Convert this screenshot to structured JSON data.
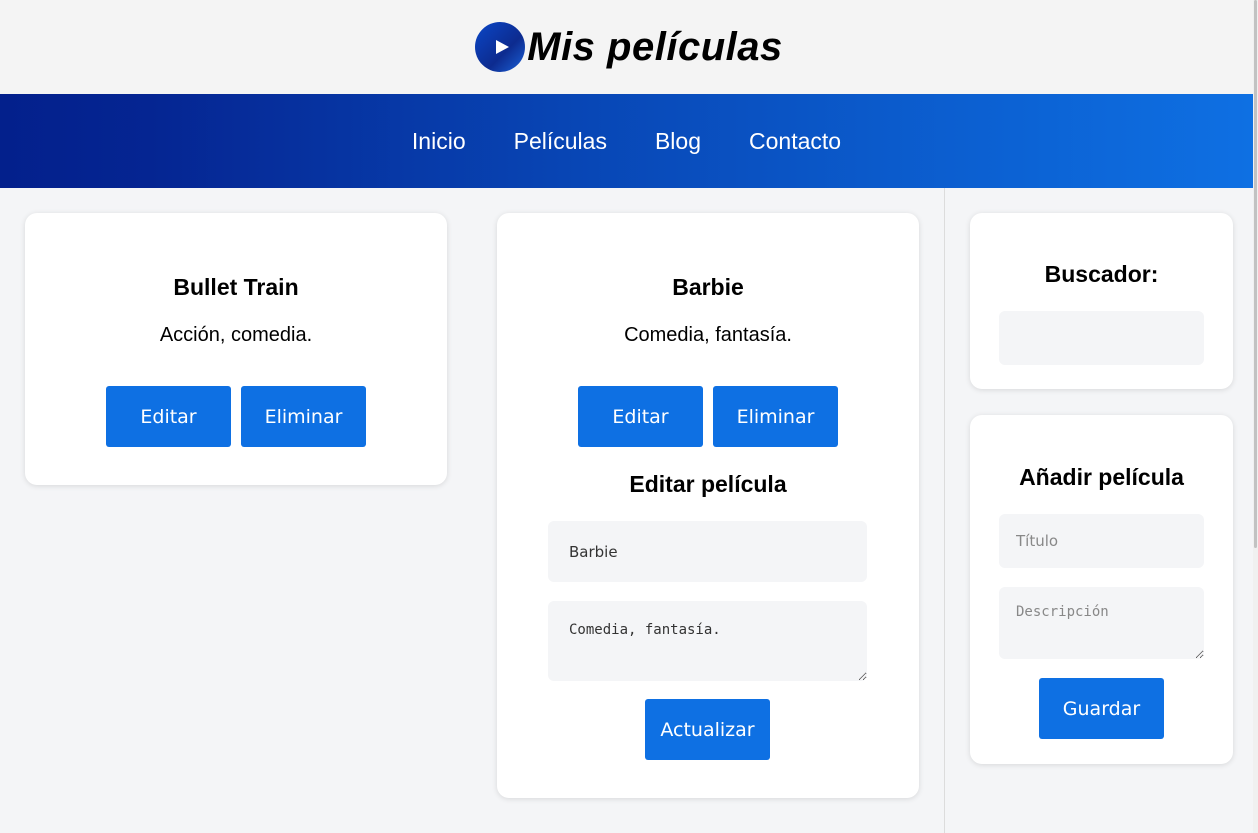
{
  "header": {
    "icon": "play-circle-icon",
    "title": "Mis películas"
  },
  "nav": {
    "items": [
      "Inicio",
      "Películas",
      "Blog",
      "Contacto"
    ]
  },
  "movies": [
    {
      "title": "Bullet Train",
      "description": "Acción, comedia.",
      "edit_label": "Editar",
      "delete_label": "Eliminar"
    },
    {
      "title": "Barbie",
      "description": "Comedia, fantasía.",
      "edit_label": "Editar",
      "delete_label": "Eliminar",
      "edit_form": {
        "heading": "Editar película",
        "title_value": "Barbie",
        "description_value": "Comedia, fantasía.",
        "submit_label": "Actualizar"
      }
    }
  ],
  "sidebar": {
    "search": {
      "heading": "Buscador:",
      "value": ""
    },
    "add_movie": {
      "heading": "Añadir película",
      "title_placeholder": "Título",
      "description_placeholder": "Descripción",
      "save_label": "Guardar"
    }
  },
  "colors": {
    "accent": "#0e70e3",
    "nav_start": "#03208c",
    "nav_end": "#0e70e3",
    "background": "#f4f5f7"
  }
}
